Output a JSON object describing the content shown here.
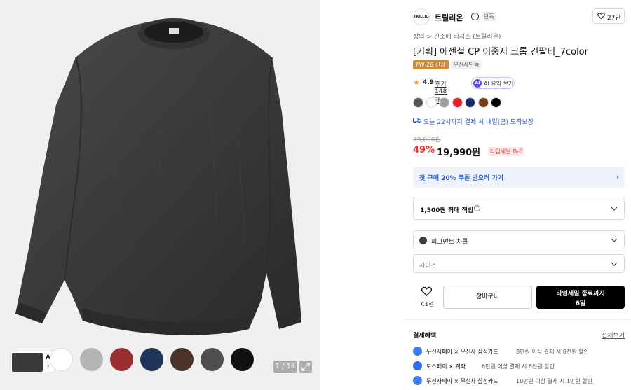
{
  "gallery": {
    "counter": "1 / 14",
    "ai_thumb_label": "AI",
    "ai_thumb_arrow": "›",
    "thumbnail_swatches": [
      "#ffffff",
      "#b5b5b5",
      "#9b2c2f",
      "#1f3557",
      "#4a3327",
      "#4f4f4f",
      "#111111"
    ]
  },
  "brand": {
    "logo_text": "TRILLION",
    "name": "트릴리온",
    "info_glyph": "i",
    "tag": "단독",
    "likes": "27만"
  },
  "breadcrumb": "상의 > 긴소매 티셔츠 (트릴리온)",
  "title": "[기획] 에센셜 CP 이중지 크롭 긴팔티_7color",
  "badges": {
    "new": "FW 26 신상",
    "exclusive": "무신사단독"
  },
  "rating": {
    "score": "4.9",
    "reviews": "후기 148개",
    "ai_summary": "AI 요약 보기",
    "ai_label": "AI"
  },
  "colors": [
    "#555555",
    "#ffffff",
    "#9e9e9e",
    "#e0202a",
    "#1a2a6c",
    "#7a3b10",
    "#000000"
  ],
  "delivery": "오늘 22시까지 결제 시 내일(금) 도착보장",
  "price": {
    "original": "39,000원",
    "discount": "49%",
    "final": "19,990원",
    "timesale_badge": "타임세일 D-6"
  },
  "coupon": {
    "label": "첫 구매 20% 쿠폰 받으러 가기",
    "chevron": "›"
  },
  "points": {
    "label": "1,500원 최대 적립",
    "info_glyph": "i"
  },
  "options": {
    "color_value": "피그먼트 차콜",
    "size_placeholder": "사이즈"
  },
  "actions": {
    "wishlist_count": "7.1천",
    "cart": "장바구니",
    "buy_line1": "타임세일 종료까지",
    "buy_line2": "6일"
  },
  "benefits": {
    "heading": "결제혜택",
    "more": "전체보기",
    "items": [
      {
        "name": "무신사페이 × 무신사 삼성카드",
        "desc": "8만원 이상 결제 시 8천원 할인",
        "icon_color": "#3e7cf0"
      },
      {
        "name": "토스페이 × 계좌",
        "desc": "6만원 이상 결제 시 6천원 할인",
        "icon_color": "#2f6ff0"
      },
      {
        "name": "무신사페이 × 무신사 삼성카드",
        "desc": "10만원 이상 결제 시 1만원 할인",
        "icon_color": "#3e7cf0"
      }
    ]
  }
}
